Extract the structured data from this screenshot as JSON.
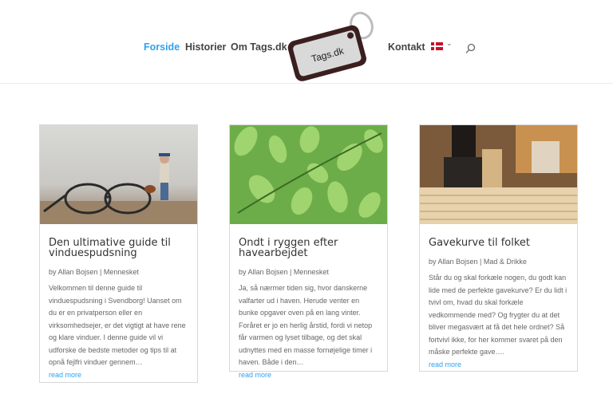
{
  "nav": {
    "items": [
      "Forside",
      "Historier",
      "Om Tags.dk",
      "Kontakt"
    ],
    "logo_text": "Tags.dk",
    "active_color": "#2ea3f2",
    "language_flag": "danish-flag-icon"
  },
  "posts": [
    {
      "title": "Den ultimative guide til vinduespudsning",
      "meta": "by Allan Bojsen | Mennesket",
      "excerpt": "Velkommen til denne guide til vinduespudsning i Svendborg! Uanset om du er en privatperson eller en virksomhedsejer, er det vigtigt at have rene og klare vinduer. I denne guide vil vi udforske de bedste metoder og tips til at opnå fejlfri vinduer gennem…",
      "read_more": "read more"
    },
    {
      "title": "Ondt i ryggen efter havearbejdet",
      "meta": "by Allan Bojsen | Mennesket",
      "excerpt": "Ja, så nærmer tiden sig, hvor danskerne valfarter ud i haven. Herude venter en bunke opgaver oven på en lang vinter. Foråret er jo en herlig årstid, fordi vi netop får varmen og lyset tilbage, og det skal udnyttes med en masse fornøjelige timer i haven. Både i den…",
      "read_more": "read more"
    },
    {
      "title": "Gavekurve til folket",
      "meta": "by Allan Bojsen | Mad & Drikke",
      "excerpt": "Står du og skal forkæle nogen, du godt kan lide med de perfekte gavekurve? Er du lidt i tvivl om, hvad du skal forkæle vedkommende med? Og frygter du at det bliver megasvært at få det hele ordnet? Så fortvivl ikke, for her kommer svaret på den måske perfekte gave….",
      "read_more": "read more"
    }
  ]
}
